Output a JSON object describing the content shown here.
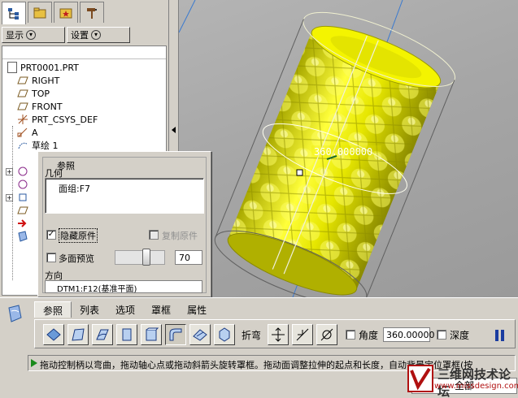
{
  "tree_panel": {
    "tabs": [
      "tree-tab",
      "folder-tab",
      "favorites-tab",
      "tools-tab"
    ],
    "toolbar": {
      "show_label": "显示",
      "settings_label": "设置"
    },
    "items": [
      {
        "label": "PRT0001.PRT",
        "icon": "part-icon"
      },
      {
        "label": "RIGHT",
        "icon": "datum-plane-icon"
      },
      {
        "label": "TOP",
        "icon": "datum-plane-icon"
      },
      {
        "label": "FRONT",
        "icon": "datum-plane-icon"
      },
      {
        "label": "PRT_CSYS_DEF",
        "icon": "csys-icon"
      },
      {
        "label": "A",
        "icon": "datum-axis-icon"
      },
      {
        "label": "草绘 1",
        "icon": "sketch-icon"
      }
    ]
  },
  "viewport": {
    "angle_label": "360.000000",
    "colors": {
      "model": "#e6e600",
      "background": "#a8a8a8",
      "axis": "#3a7ad0"
    }
  },
  "ref_panel": {
    "legend": "参照",
    "geometry_label": "几何",
    "geometry_item": "面组:F7",
    "hide_original": "隐藏原件",
    "hide_original_checked": true,
    "copy_original": "复制原件",
    "multi_preview": "多面预览",
    "slider_value": "70",
    "direction_label": "方向",
    "direction_value": "DTM1:F12(基准平面)"
  },
  "dashboard": {
    "tabs": [
      "参照",
      "列表",
      "选项",
      "罩框",
      "属性"
    ],
    "active_tab": 0,
    "bend_label": "折弯",
    "angle_label": "角度",
    "angle_value": "360.00000",
    "depth_label": "深度",
    "message": "拖动控制柄以弯曲，拖动轴心点或拖动斜箭头旋转罩框。拖动面调整拉伸的起点和长度，自动背景定位罩框(按",
    "status_filter": "全部"
  },
  "watermark": {
    "title": "三维网技术论坛",
    "url": "www.missdesign.com"
  }
}
